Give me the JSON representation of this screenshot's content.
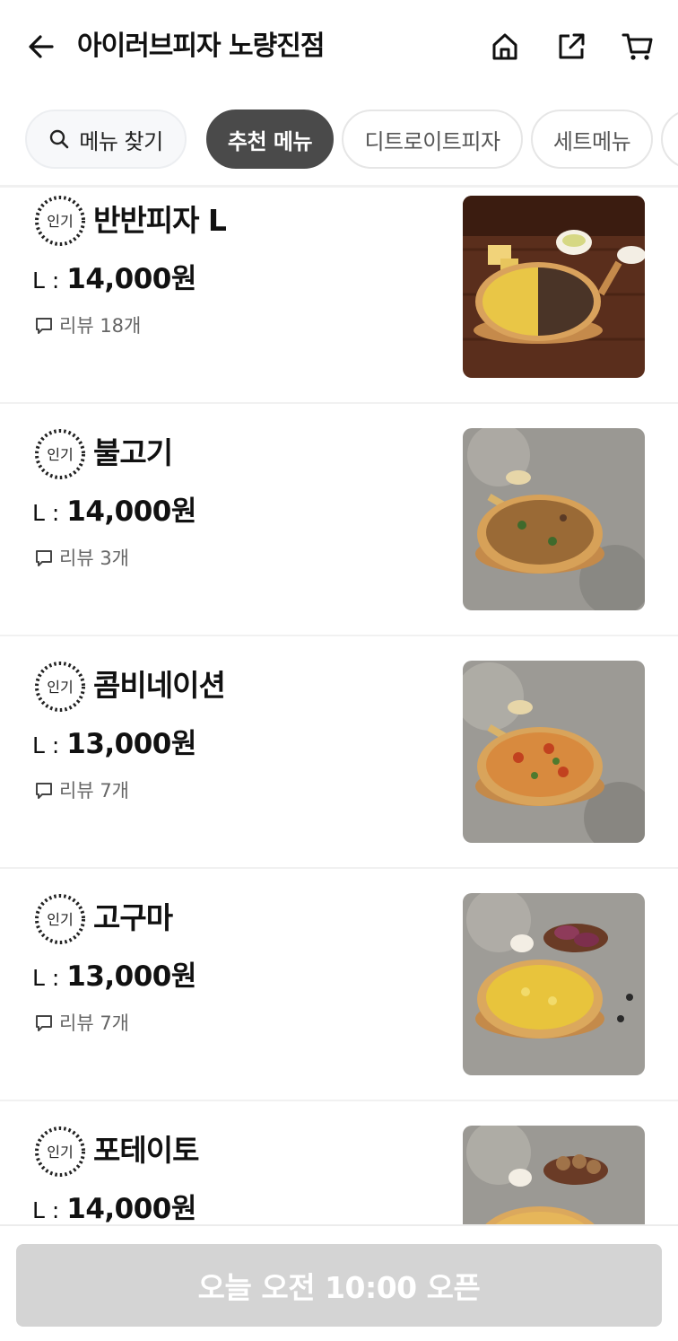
{
  "header": {
    "title": "아이러브피자 노량진점",
    "back_icon": "arrow-left-icon",
    "home_icon": "home-icon",
    "share_icon": "share-icon",
    "cart_icon": "cart-icon"
  },
  "categories": {
    "search_label": "메뉴 찾기",
    "tabs": [
      {
        "label": "추천 메뉴",
        "active": true
      },
      {
        "label": "디트로이트피자",
        "active": false
      },
      {
        "label": "세트메뉴",
        "active": false
      }
    ]
  },
  "menu": {
    "badge_text": "인기",
    "review_prefix": "리뷰",
    "items": [
      {
        "name": "반반피자 L",
        "size": "L : ",
        "price": "14,000원",
        "reviews": "리뷰 18개",
        "image": "half-half-pizza"
      },
      {
        "name": "불고기",
        "size": "L : ",
        "price": "14,000원",
        "reviews": "리뷰 3개",
        "image": "bulgogi-pizza"
      },
      {
        "name": "콤비네이션",
        "size": "L : ",
        "price": "13,000원",
        "reviews": "리뷰 7개",
        "image": "combination-pizza"
      },
      {
        "name": "고구마",
        "size": "L : ",
        "price": "13,000원",
        "reviews": "리뷰 7개",
        "image": "sweet-potato-pizza"
      },
      {
        "name": "포테이토",
        "size": "L : ",
        "price": "14,000원",
        "reviews": "",
        "image": "potato-pizza"
      }
    ]
  },
  "bottom": {
    "open_label": "오늘 오전 10:00 오픈"
  },
  "colors": {
    "active_chip": "#4a4a4a",
    "disabled_button": "#d4d4d4"
  }
}
